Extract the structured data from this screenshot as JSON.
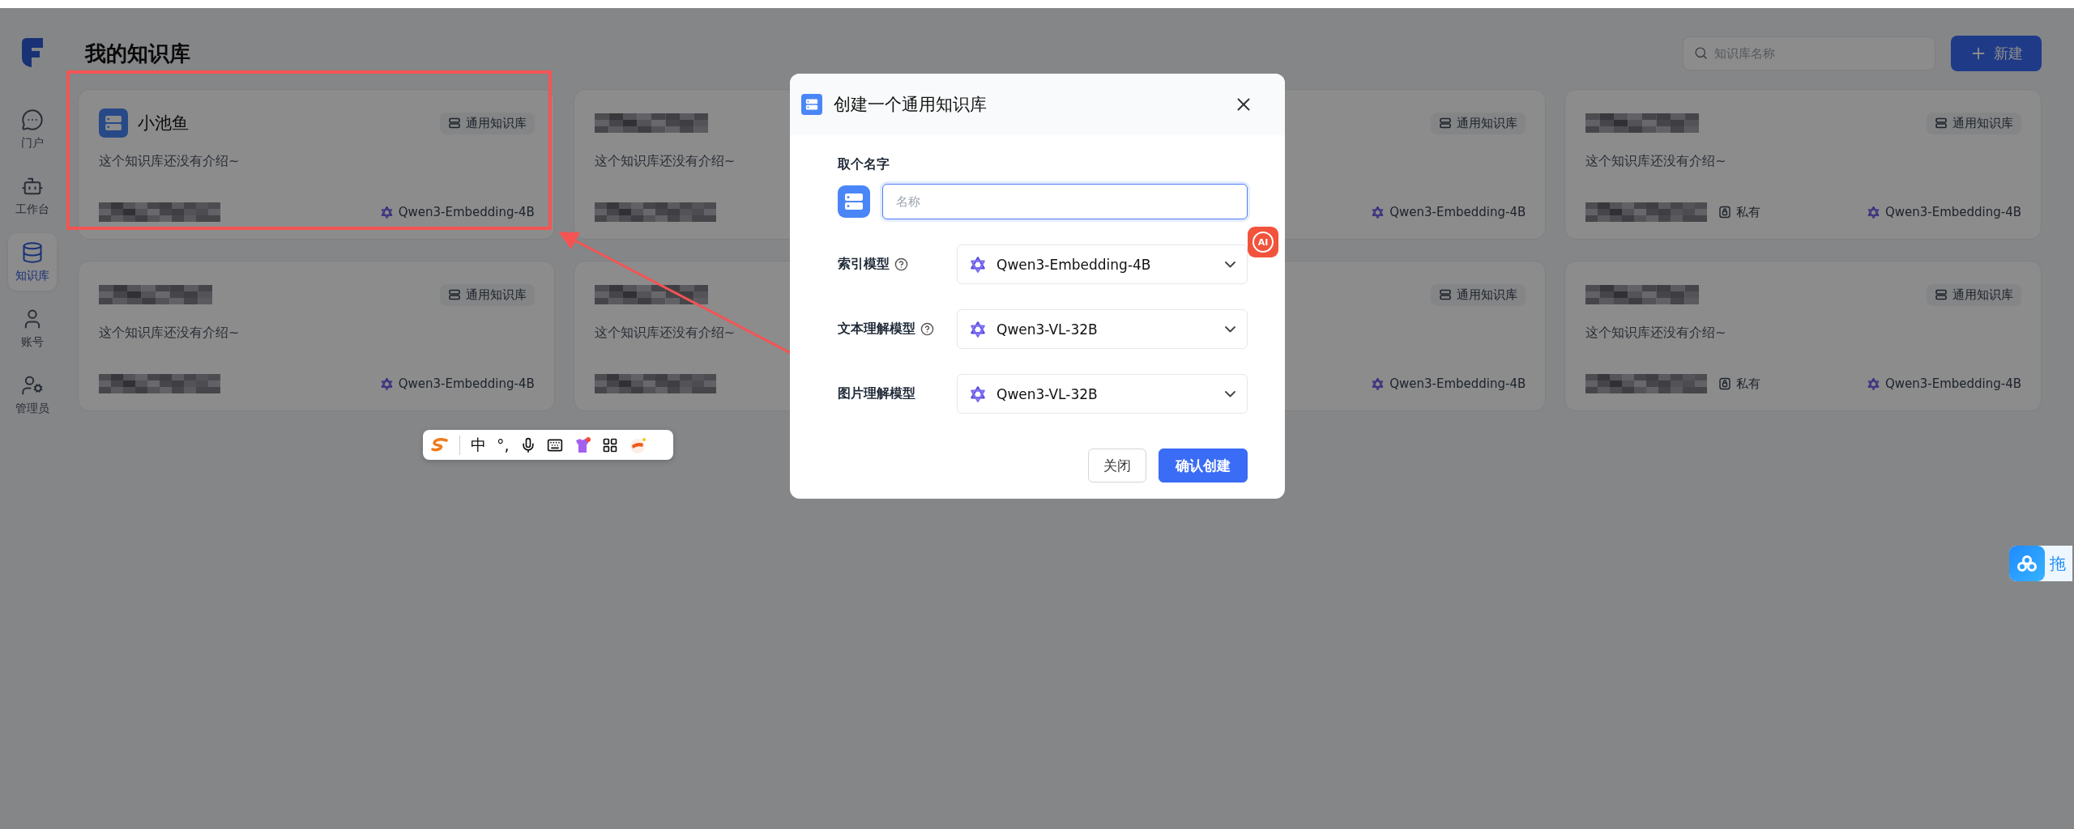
{
  "sidebar": {
    "items": [
      {
        "label": "门户",
        "kind": "chat",
        "selected": false
      },
      {
        "label": "工作台",
        "kind": "robot",
        "selected": false
      },
      {
        "label": "知识库",
        "kind": "database",
        "selected": true
      },
      {
        "label": "账号",
        "kind": "user",
        "selected": false
      },
      {
        "label": "管理员",
        "kind": "admin",
        "selected": false
      }
    ]
  },
  "page": {
    "title": "我的知识库",
    "search": {
      "placeholder": "知识库名称"
    },
    "new_button": "新建"
  },
  "cards": [
    {
      "title": {
        "kind": "text",
        "text": "小池鱼"
      },
      "description": "这个知识库还没有介绍~",
      "tag": "通用知识库",
      "owner_pixelated": true,
      "model": "Qwen3-Embedding-4B"
    },
    {
      "title": {
        "kind": "pixelated"
      },
      "description": "这个知识库还没有介绍~",
      "owner_pixelated": true
    },
    {
      "tag": "通用知识库",
      "model": "Qwen3-Embedding-4B"
    },
    {
      "title": {
        "kind": "pixelated"
      },
      "description": "这个知识库还没有介绍~",
      "tag": "通用知识库",
      "owner_pixelated": true,
      "privacy": "私有",
      "model": "Qwen3-Embedding-4B"
    },
    {
      "title": {
        "kind": "pixelated"
      },
      "description": "这个知识库还没有介绍~",
      "tag": "通用知识库",
      "owner_pixelated": true,
      "model": "Qwen3-Embedding-4B"
    },
    {
      "title": {
        "kind": "pixelated"
      },
      "description": "这个知识库还没有介绍~",
      "owner_pixelated": true
    },
    {
      "tag": "通用知识库",
      "model": "Qwen3-Embedding-4B"
    },
    {
      "title": {
        "kind": "pixelated"
      },
      "description": "这个知识库还没有介绍~",
      "tag": "通用知识库",
      "owner_pixelated": true,
      "privacy": "私有",
      "model": "Qwen3-Embedding-4B"
    }
  ],
  "dialog": {
    "title": "创建一个通用知识库",
    "name_label": "取个名字",
    "name_field": {
      "placeholder": "名称",
      "focused": true
    },
    "fields": [
      {
        "label": "索引模型",
        "help": true,
        "value": "Qwen3-Embedding-4B"
      },
      {
        "label": "文本理解模型",
        "help": true,
        "value": "Qwen3-VL-32B"
      },
      {
        "label": "图片理解模型",
        "help": false,
        "value": "Qwen3-VL-32B"
      }
    ],
    "buttons": [
      {
        "label": "关闭",
        "kind": "secondary"
      },
      {
        "label": "确认创建",
        "kind": "primary"
      }
    ]
  },
  "ai_badge": {
    "label": "AI"
  },
  "ime_toolbar": {
    "mode": "中",
    "punctuation": "°,"
  },
  "side_widget": {
    "label": "拖"
  }
}
